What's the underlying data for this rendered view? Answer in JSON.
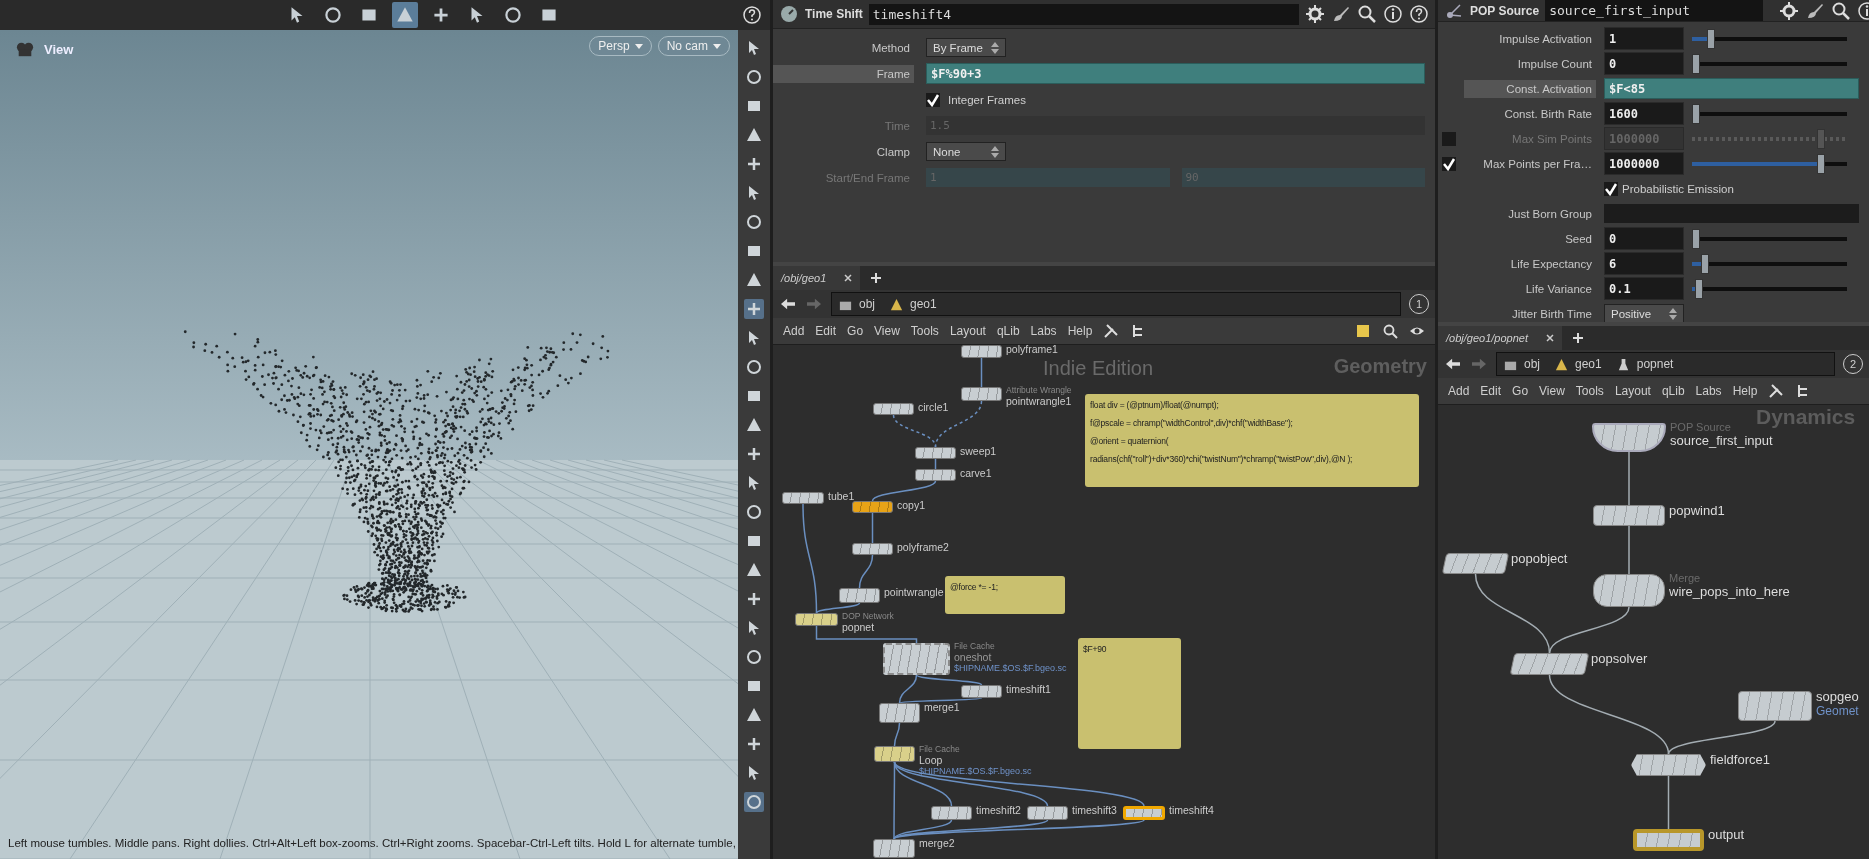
{
  "viewport": {
    "title": "View",
    "camera_menus": [
      "Persp",
      "No cam"
    ],
    "status": "Left mouse tumbles. Middle pans. Right dollies. Ctrl+Alt+Left box-zooms. Ctrl+Right zooms. Spacebar-Ctrl-Left tilts. Hold L for alternate tumble,",
    "top_tools": [
      {
        "selected": false
      },
      {
        "selected": false
      },
      {
        "selected": false
      },
      {
        "selected": true
      },
      {
        "selected": false
      },
      {
        "selected": false
      },
      {
        "selected": false
      },
      {
        "selected": false
      }
    ],
    "side_tools": [
      {
        "selected": false
      },
      {
        "selected": false
      },
      {
        "selected": false
      },
      {
        "selected": false
      },
      {
        "selected": false
      },
      {
        "selected": false
      },
      {
        "selected": false
      },
      {
        "selected": false
      },
      {
        "selected": false
      },
      {
        "selected": true
      },
      {
        "selected": false
      },
      {
        "selected": false
      },
      {
        "selected": false
      },
      {
        "selected": false
      },
      {
        "selected": false
      },
      {
        "selected": false
      },
      {
        "selected": false
      },
      {
        "selected": false
      },
      {
        "selected": false
      },
      {
        "selected": false
      },
      {
        "selected": false
      },
      {
        "selected": false
      },
      {
        "selected": false
      },
      {
        "selected": false
      },
      {
        "selected": false
      },
      {
        "selected": false
      },
      {
        "selected": true
      }
    ]
  },
  "time_shift": {
    "type": "Time Shift",
    "name": "timeshift4",
    "params": [
      {
        "kind": "menu",
        "label": "Method",
        "value": "By Frame",
        "disabled": false
      },
      {
        "kind": "expression",
        "label": "Frame",
        "value": "$F%90+3",
        "disabled": false
      },
      {
        "kind": "toggle",
        "label": "Integer Frames",
        "checked": true,
        "disabled": false
      },
      {
        "kind": "text",
        "label": "Time",
        "value": "1.5",
        "disabled": true
      },
      {
        "kind": "menu",
        "label": "Clamp",
        "value": "None",
        "disabled": false
      },
      {
        "kind": "pair",
        "label": "Start/End Frame",
        "values": [
          "1",
          "90"
        ],
        "disabled": true
      }
    ]
  },
  "pop_source": {
    "type": "POP Source",
    "name": "source_first_input",
    "params": [
      {
        "kind": "slider",
        "label": "Impulse Activation",
        "value": "1",
        "level": 0.1,
        "disabled": false
      },
      {
        "kind": "slider",
        "label": "Impulse Count",
        "value": "0",
        "level": 0,
        "disabled": false
      },
      {
        "kind": "expression",
        "label": "Const. Activation",
        "value": "$F<85",
        "disabled": false
      },
      {
        "kind": "slider",
        "label": "Const. Birth Rate",
        "value": "1600",
        "level": 0,
        "disabled": false
      },
      {
        "kind": "slider",
        "label": "Max Sim Points",
        "value": "1000000",
        "level": 0.85,
        "toggle": false,
        "disabled": true
      },
      {
        "kind": "slider",
        "label": "Max Points per Fra…",
        "value": "1000000",
        "level": 0.85,
        "toggle": true,
        "disabled": false
      },
      {
        "kind": "toggle",
        "label": "Probabilistic Emission",
        "checked": true,
        "disabled": false
      },
      {
        "kind": "text",
        "label": "Just Born Group",
        "disabled": false
      },
      {
        "kind": "slider",
        "label": "Seed",
        "value": "0",
        "level": 0,
        "disabled": false
      },
      {
        "kind": "slider",
        "label": "Life Expectancy",
        "value": "6",
        "level": 0.06,
        "disabled": false
      },
      {
        "kind": "slider",
        "label": "Life Variance",
        "value": "0.1",
        "level": 0.02,
        "disabled": false
      },
      {
        "kind": "menu",
        "label": "Jitter Birth Time",
        "value": "Positive",
        "disabled": false
      }
    ]
  },
  "geo_network": {
    "tab": "/obj/geo1",
    "path": [
      "obj",
      "geo1"
    ],
    "pane_number": "1",
    "menu": [
      "Add",
      "Edit",
      "Go",
      "View",
      "Tools",
      "Layout",
      "qLib",
      "Labs",
      "Help"
    ],
    "edition": "Indie Edition",
    "context": "Geometry",
    "nodes": [
      {
        "label": "polyframe1",
        "color": "#c8ced2",
        "selected": false,
        "disabled": false
      },
      {
        "label": "pointwrangle1",
        "subtitle": "Attribute Wrangle",
        "color": "#c8ced2",
        "selected": false,
        "disabled": false
      },
      {
        "label": "circle1",
        "color": "#c8ced2",
        "selected": false,
        "disabled": false
      },
      {
        "label": "sweep1",
        "color": "#c8ced2",
        "selected": false,
        "disabled": false
      },
      {
        "label": "carve1",
        "color": "#c8ced2",
        "selected": false,
        "disabled": false
      },
      {
        "label": "tube1",
        "color": "#c8ced2",
        "selected": false,
        "disabled": false
      },
      {
        "label": "copy1",
        "color": "#e8a317",
        "selected": false,
        "disabled": false
      },
      {
        "label": "polyframe2",
        "color": "#c8ced2",
        "selected": false,
        "disabled": false
      },
      {
        "label": "pointwrangle",
        "color": "#c8ced2",
        "selected": false,
        "disabled": false
      },
      {
        "label": "popnet",
        "subtitle": "DOP Network",
        "color": "#d9d08a",
        "selected": false,
        "disabled": false
      },
      {
        "label": "oneshot",
        "subtitle": "File Cache",
        "path": "$HIPNAME.$OS.$F.bgeo.sc",
        "color": "#c8ced2",
        "selected": false,
        "disabled": true
      },
      {
        "label": "timeshift1",
        "color": "#c8ced2",
        "selected": false,
        "disabled": false
      },
      {
        "label": "merge1",
        "color": "#c8ced2",
        "selected": false,
        "disabled": false
      },
      {
        "label": "Loop",
        "subtitle": "File Cache",
        "path": "$HIPNAME.$OS.$F.bgeo.sc",
        "color": "#d9d08a",
        "selected": false,
        "disabled": false
      },
      {
        "label": "timeshift2",
        "color": "#c8ced2",
        "selected": false,
        "disabled": false
      },
      {
        "label": "timeshift3",
        "color": "#c8ced2",
        "selected": false,
        "disabled": false
      },
      {
        "label": "timeshift4",
        "color": "#c8ced2",
        "selected": true,
        "disabled": false
      },
      {
        "label": "merge2",
        "color": "#c8ced2",
        "selected": false,
        "disabled": false
      }
    ],
    "notes": [
      {
        "lines": [
          "float div = (@ptnum)/float(@numpt);",
          "f@pscale = chramp(\"widthControl\",div)*chf(\"widthBase\");",
          "@orient = quaternion(",
          "radians(chf(\"roll\")+div*360)*chi(\"twistNum\")*chramp(\"twistPow\",div),@N );"
        ]
      },
      {
        "lines": [
          "@force *= -1;"
        ]
      },
      {
        "lines": [
          "$F+90"
        ]
      }
    ]
  },
  "pop_network": {
    "tab": "/obj/geo1/popnet",
    "path": [
      "obj",
      "geo1",
      "popnet"
    ],
    "pane_number": "2",
    "menu": [
      "Add",
      "Edit",
      "Go",
      "View",
      "Tools",
      "Layout",
      "qLib",
      "Labs",
      "Help"
    ],
    "context": "Dynamics",
    "nodes": [
      {
        "kind": "dome",
        "label": "source_first_input",
        "subtitle": "POP Source",
        "display": false
      },
      {
        "kind": "box",
        "label": "popwind1",
        "display": false
      },
      {
        "kind": "slant",
        "label": "popobject",
        "display": false
      },
      {
        "kind": "merge",
        "label": "wire_pops_into_here",
        "subtitle": "Merge",
        "display": false
      },
      {
        "kind": "slant",
        "label": "popsolver",
        "display": false
      },
      {
        "kind": "box",
        "label": "sopgeo",
        "path": "Geomet",
        "display": false
      },
      {
        "kind": "hex",
        "label": "fieldforce1",
        "display": false
      },
      {
        "kind": "box",
        "label": "output",
        "display": true
      }
    ]
  }
}
